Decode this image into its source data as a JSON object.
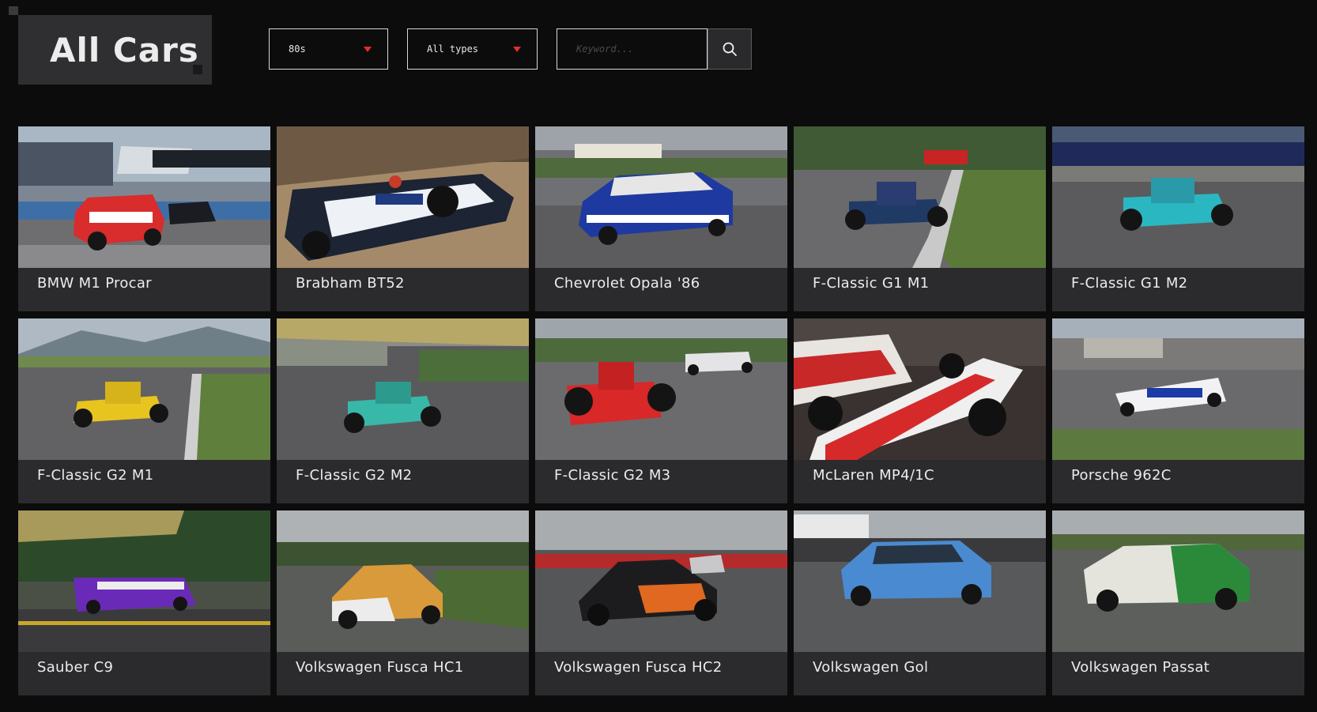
{
  "page": {
    "title": "All Cars"
  },
  "filters": {
    "decade": "80s",
    "type": "All types",
    "search_placeholder": "Keyword...",
    "accent_color": "#e52b2b"
  },
  "icons": {
    "search": "search-icon",
    "dropdown": "caret-down-icon"
  },
  "cars": [
    {
      "name": "BMW M1 Procar"
    },
    {
      "name": "Brabham BT52"
    },
    {
      "name": "Chevrolet Opala '86"
    },
    {
      "name": "F-Classic G1 M1"
    },
    {
      "name": "F-Classic G1 M2"
    },
    {
      "name": "F-Classic G2 M1"
    },
    {
      "name": "F-Classic G2 M2"
    },
    {
      "name": "F-Classic G2 M3"
    },
    {
      "name": "McLaren MP4/1C"
    },
    {
      "name": "Porsche 962C"
    },
    {
      "name": "Sauber C9"
    },
    {
      "name": "Volkswagen Fusca HC1"
    },
    {
      "name": "Volkswagen Fusca HC2"
    },
    {
      "name": "Volkswagen Gol"
    },
    {
      "name": "Volkswagen Passat"
    }
  ]
}
